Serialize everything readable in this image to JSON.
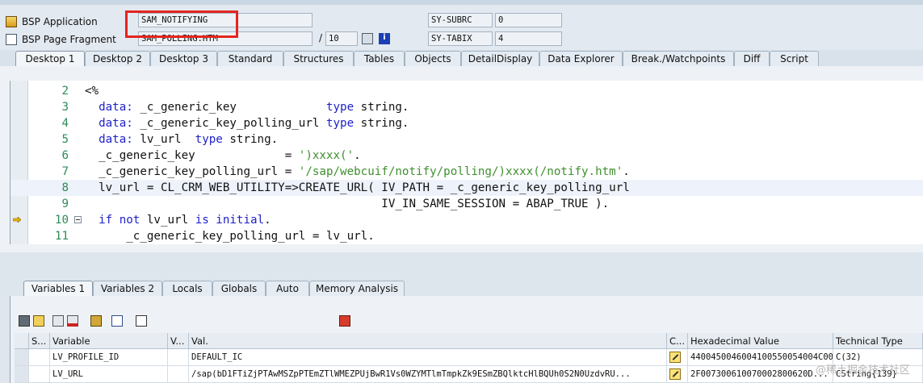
{
  "header": {
    "bsp_application_label": "BSP Application",
    "bsp_application_value": "SAM_NOTIFYING",
    "bsp_page_fragment_label": "BSP Page Fragment",
    "bsp_page_fragment_value": "SAM_POLLING.HTM",
    "page_slash": "/",
    "page_total": "10",
    "sy_subrc_label": "SY-SUBRC",
    "sy_subrc_value": "0",
    "sy_tabix_label": "SY-TABIX",
    "sy_tabix_value": "4",
    "highlight_color": "#e3251f"
  },
  "tabs": [
    "Desktop 1",
    "Desktop 2",
    "Desktop 3",
    "Standard",
    "Structures",
    "Tables",
    "Objects",
    "DetailDisplay",
    "Data Explorer",
    "Break./Watchpoints",
    "Diff",
    "Script"
  ],
  "code": {
    "lines": [
      {
        "num": "2",
        "segments": [
          {
            "t": "<%",
            "c": "id"
          }
        ]
      },
      {
        "num": "3",
        "segments": [
          {
            "t": "  data:",
            "c": "kw"
          },
          {
            "t": " _c_generic_key             ",
            "c": "id"
          },
          {
            "t": "type",
            "c": "kw"
          },
          {
            "t": " string.",
            "c": "id"
          }
        ]
      },
      {
        "num": "4",
        "segments": [
          {
            "t": "  data:",
            "c": "kw"
          },
          {
            "t": " _c_generic_key_polling_url ",
            "c": "id"
          },
          {
            "t": "type",
            "c": "kw"
          },
          {
            "t": " string.",
            "c": "id"
          }
        ]
      },
      {
        "num": "5",
        "segments": [
          {
            "t": "  data:",
            "c": "kw"
          },
          {
            "t": " lv_url  ",
            "c": "id"
          },
          {
            "t": "type",
            "c": "kw"
          },
          {
            "t": " string.",
            "c": "id"
          }
        ]
      },
      {
        "num": "6",
        "segments": [
          {
            "t": "  _c_generic_key             = ",
            "c": "id"
          },
          {
            "t": "')xxxx('",
            "c": "str"
          },
          {
            "t": ".",
            "c": "id"
          }
        ]
      },
      {
        "num": "7",
        "segments": [
          {
            "t": "  _c_generic_key_polling_url = ",
            "c": "id"
          },
          {
            "t": "'/sap/webcuif/notify/polling/)xxxx(/notify.htm'",
            "c": "str"
          },
          {
            "t": ".",
            "c": "id"
          }
        ]
      },
      {
        "num": "8",
        "segments": [
          {
            "t": "  lv_url = CL_CRM_WEB_UTILITY=>CREATE_URL( IV_PATH = _c_generic_key_polling_url",
            "c": "id"
          }
        ]
      },
      {
        "num": "9",
        "segments": [
          {
            "t": "                                           IV_IN_SAME_SESSION = ABAP_TRUE ).",
            "c": "id"
          }
        ]
      },
      {
        "num": "10",
        "segments": [
          {
            "t": "  ",
            "c": "id"
          },
          {
            "t": "if not",
            "c": "kw"
          },
          {
            "t": " lv_url ",
            "c": "id"
          },
          {
            "t": "is initial",
            "c": "kw"
          },
          {
            "t": ".",
            "c": "id"
          }
        ]
      },
      {
        "num": "11",
        "segments": [
          {
            "t": "      _c_generic_key_polling_url = lv_url.",
            "c": "id"
          }
        ]
      }
    ],
    "current_line_index": 6,
    "execution_line_index": 8,
    "fold_line_index": 8
  },
  "lower_tabs": [
    "Variables 1",
    "Variables 2",
    "Locals",
    "Globals",
    "Auto",
    "Memory Analysis"
  ],
  "toolbar_icons": [
    "delete-icon",
    "list-icon",
    "copy-list-icon",
    "save-list-icon",
    "hierarchy-icon",
    "arrows-icon",
    "select-icon",
    "floppy-icon"
  ],
  "table": {
    "columns": [
      "S...",
      "Variable",
      "V...",
      "Val.",
      "C...",
      "Hexadecimal Value",
      "Technical Type"
    ],
    "rows": [
      {
        "variable": "LV_PROFILE_ID",
        "val": "DEFAULT_IC",
        "hex": "4400450046004100550054004C00...",
        "type": "C(32)"
      },
      {
        "variable": "LV_URL",
        "val": "/sap(bD1FTiZjPTAwMSZpPTEmZTlWMEZPUjBwR1Vs0WZYMTlmTmpkZk9ESmZBQlktcHlBQUh0S2N0UzdvRU...",
        "hex": "2F007300610070002800620D...",
        "type": "CString{139}"
      }
    ]
  },
  "watermark": "@稀土掘金技术社区"
}
